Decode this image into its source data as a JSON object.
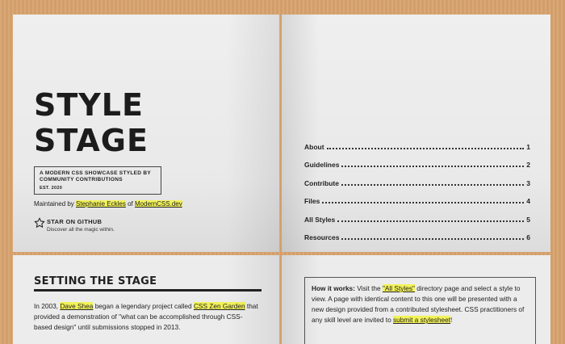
{
  "hero": {
    "title_line1": "STYLE",
    "title_line2": "STAGE",
    "tagline": "A MODERN CSS SHOWCASE STYLED BY COMMUNITY CONTRIBUTIONS",
    "est": "EST. 2020",
    "maintained_prefix": "Maintained by",
    "maintainer": "Stephanie Eckles",
    "of": "of",
    "site": "ModernCSS.dev",
    "github_title": "STAR ON GITHUB",
    "github_sub": "Discover all the magic within."
  },
  "toc": [
    {
      "label": "About",
      "page": "1"
    },
    {
      "label": "Guidelines",
      "page": "2"
    },
    {
      "label": "Contribute",
      "page": "3"
    },
    {
      "label": "Files",
      "page": "4"
    },
    {
      "label": "All Styles",
      "page": "5"
    },
    {
      "label": "Resources",
      "page": "6"
    }
  ],
  "setting": {
    "heading": "SETTING THE STAGE",
    "p1": "In 2003,",
    "link1": "Dave Shea",
    "p2": "began a legendary project called",
    "link2": "CSS Zen Garden",
    "p3": "that provided a demonstration of \"what can be accomplished through CSS-based design\" until submissions stopped in 2013."
  },
  "how": {
    "lead": "How it works:",
    "t1": "Visit the",
    "link1": "\"All Styles\"",
    "t2": "directory page and select a style to view. A page with identical content to this one will be presented with a new design provided from a contributed stylesheet. CSS practitioners of any skill level are invited to",
    "link2": "submit a stylesheet",
    "t3": "!"
  },
  "colors": {
    "highlight": "#f2f25a",
    "paper": "#ececec",
    "desk": "#d9a470",
    "ink": "#222222"
  }
}
